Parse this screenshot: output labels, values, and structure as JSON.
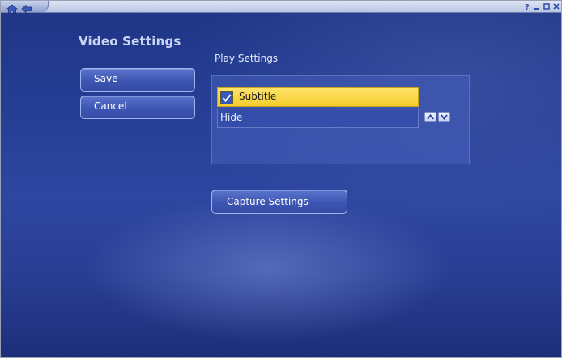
{
  "page": {
    "title": "Video Settings"
  },
  "buttons": {
    "save": "Save",
    "cancel": "Cancel",
    "capture": "Capture Settings"
  },
  "play_settings": {
    "label": "Play Settings",
    "option": {
      "label": "Subtitle",
      "checked": true
    },
    "value": "Hide"
  },
  "icons": {
    "home": "home-icon",
    "back": "back-arrow-icon",
    "help": "help-icon",
    "minimize": "minimize-icon",
    "restore": "restore-icon",
    "close": "close-icon",
    "spin_up": "chevron-up-icon",
    "spin_down": "chevron-down-icon"
  },
  "colors": {
    "background": "#2a3f95",
    "highlight": "#f5cc2c",
    "title_text": "#c9d5f5"
  }
}
